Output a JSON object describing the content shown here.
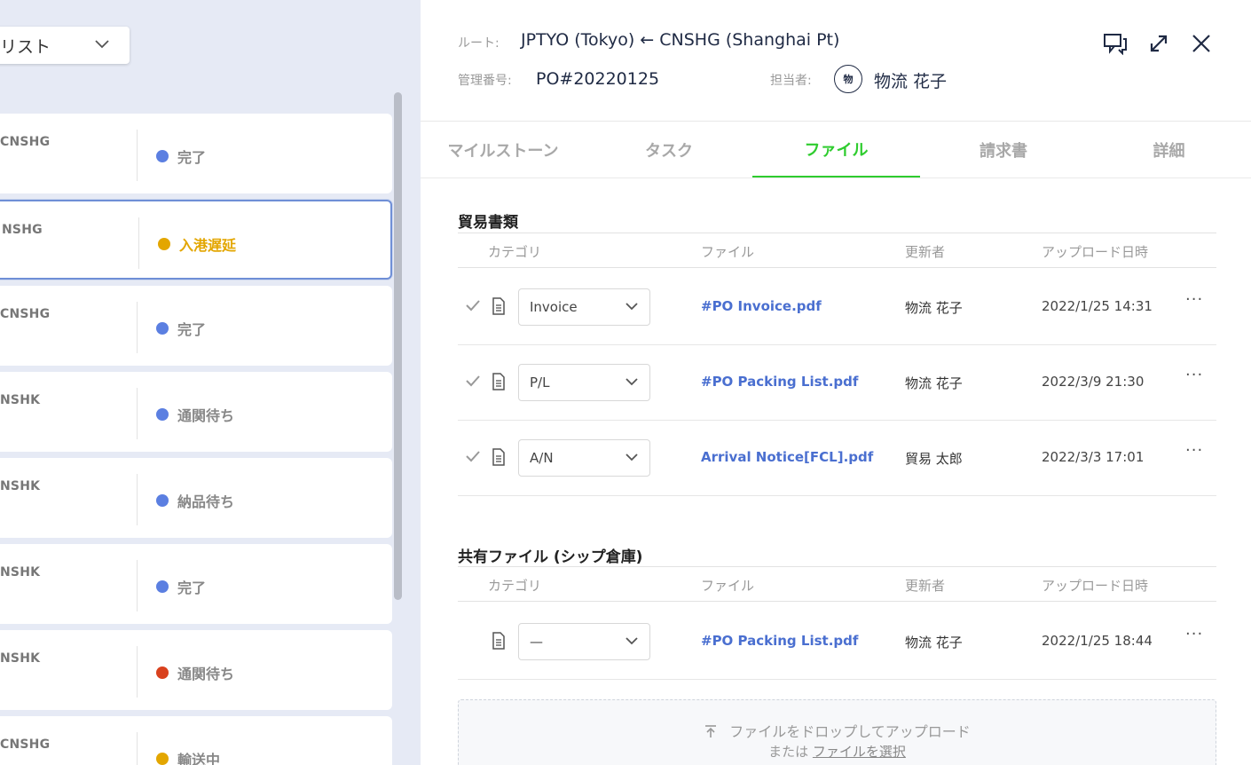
{
  "list_panel": {
    "dropdown_label": "リスト",
    "cards": [
      {
        "code": "CNSHG",
        "status": "完了",
        "dot_color": "#5b7fe1",
        "status_color": "#888888"
      },
      {
        "code": "NSHG",
        "status": "入港遅延",
        "dot_color": "#e3a600",
        "status_color": "#e3a600",
        "selected": true
      },
      {
        "code": "CNSHG",
        "status": "完了",
        "dot_color": "#5b7fe1",
        "status_color": "#888888"
      },
      {
        "code": "NSHK",
        "status": "通関待ち",
        "dot_color": "#5b7fe1",
        "status_color": "#888888"
      },
      {
        "code": "NSHK",
        "status": "納品待ち",
        "dot_color": "#5b7fe1",
        "status_color": "#888888"
      },
      {
        "code": "NSHK",
        "status": "完了",
        "dot_color": "#5b7fe1",
        "status_color": "#888888"
      },
      {
        "code": "NSHK",
        "status": "通関待ち",
        "dot_color": "#d9411e",
        "status_color": "#888888"
      },
      {
        "code": "CNSHG",
        "status": "輸送中",
        "dot_color": "#e3a600",
        "status_color": "#888888"
      }
    ]
  },
  "detail": {
    "route_label": "ルート:",
    "route_value": "JPTYO (Tokyo) ← CNSHG (Shanghai Pt)",
    "mgmt_label": "管理番号:",
    "mgmt_value": "PO#20220125",
    "assignee_label": "担当者:",
    "assignee_avatar": "物",
    "assignee_name": "物流 花子",
    "icons": [
      "chat-icon",
      "expand-icon",
      "close-icon"
    ]
  },
  "tabs": [
    {
      "label": "マイルストーン"
    },
    {
      "label": "タスク"
    },
    {
      "label": "ファイル",
      "active": true
    },
    {
      "label": "請求書"
    },
    {
      "label": "詳細"
    }
  ],
  "trade_docs": {
    "title": "貿易書類",
    "headers": {
      "category": "カテゴリ",
      "file": "ファイル",
      "updater": "更新者",
      "uploaded": "アップロード日時"
    },
    "rows": [
      {
        "category": "Invoice",
        "file": "#PO Invoice.pdf",
        "updater": "物流 花子",
        "date": "2022/1/25 14:31"
      },
      {
        "category": "P/L",
        "file": "#PO Packing List.pdf",
        "updater": "物流 花子",
        "date": "2022/3/9 21:30"
      },
      {
        "category": "A/N",
        "file": "Arrival Notice[FCL].pdf",
        "updater": "貿易 太郎",
        "date": "2022/3/3 17:01"
      }
    ]
  },
  "shared_files": {
    "title": "共有ファイル (シップ倉庫)",
    "headers": {
      "category": "カテゴリ",
      "file": "ファイル",
      "updater": "更新者",
      "uploaded": "アップロード日時"
    },
    "rows": [
      {
        "category": "—",
        "file": "#PO Packing List.pdf",
        "updater": "物流 花子",
        "date": "2022/1/25 18:44"
      }
    ]
  },
  "dropzone": {
    "line1": "ファイルをドロップしてアップロード",
    "line2_prefix": "または",
    "line2_link": "ファイルを選択"
  },
  "more_glyph": "···"
}
